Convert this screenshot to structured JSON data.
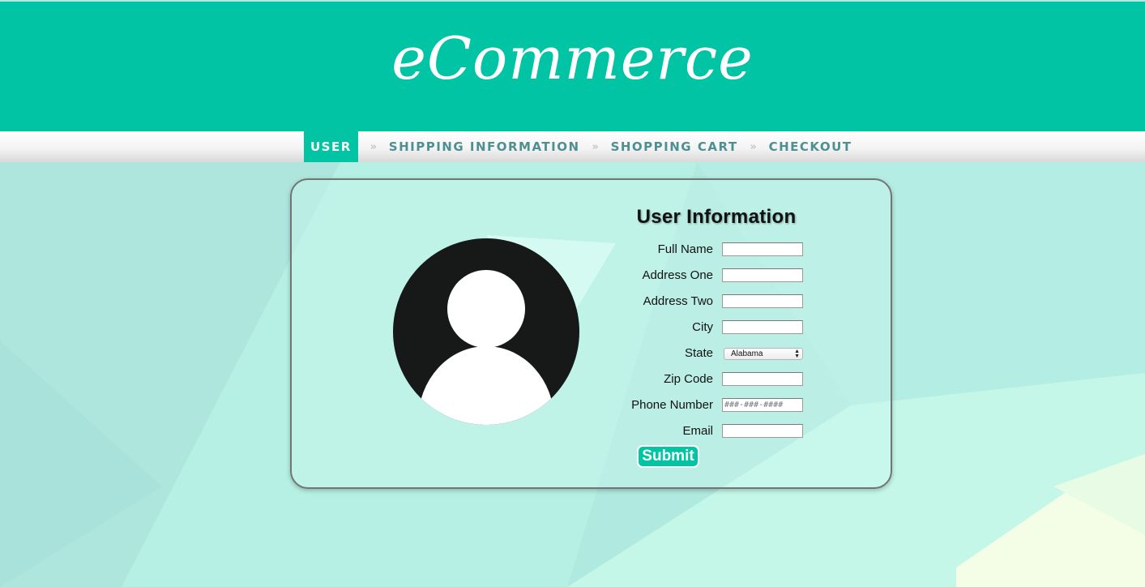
{
  "brand": {
    "title": "eCommerce"
  },
  "nav": {
    "items": [
      {
        "label": "USER",
        "active": true
      },
      {
        "label": "SHIPPING INFORMATION",
        "active": false
      },
      {
        "label": "SHOPPING CART",
        "active": false
      },
      {
        "label": "CHECKOUT",
        "active": false
      }
    ],
    "separator": "»"
  },
  "form": {
    "title": "User Information",
    "fields": [
      {
        "label": "Full Name",
        "value": "",
        "placeholder": ""
      },
      {
        "label": "Address One",
        "value": "",
        "placeholder": ""
      },
      {
        "label": "Address Two",
        "value": "",
        "placeholder": ""
      },
      {
        "label": "City",
        "value": "",
        "placeholder": ""
      },
      {
        "label": "State",
        "selected": "Alabama"
      },
      {
        "label": "Zip Code",
        "value": "",
        "placeholder": ""
      },
      {
        "label": "Phone Number",
        "value": "",
        "placeholder": "###-###-####"
      },
      {
        "label": "Email",
        "value": "",
        "placeholder": ""
      }
    ],
    "submit_label": "Submit"
  },
  "icons": {
    "avatar": "user-avatar-icon",
    "select_arrows": "up-down-arrows-icon"
  },
  "colors": {
    "accent": "#00c4a3",
    "nav_text": "#4e8f91",
    "background": "#b2ebe0"
  }
}
